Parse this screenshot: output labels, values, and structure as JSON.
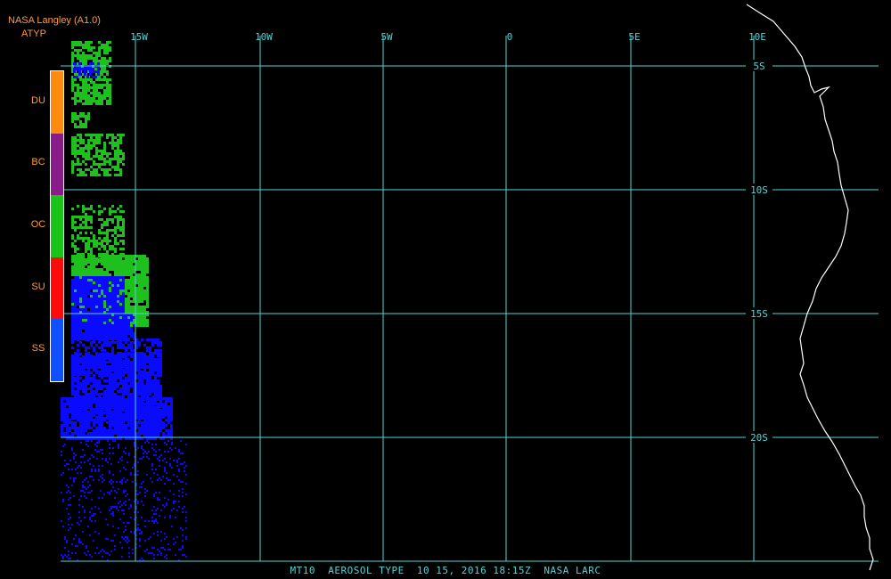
{
  "header": {
    "source": "NASA Langley (A1.0)",
    "product": "ATYP"
  },
  "colors": {
    "background": "#000000",
    "grid": "#4fd6d6",
    "coast": "#ffffff",
    "header_text": "#ff9a3c",
    "DU": "#ff8a10",
    "BC": "#8a1c8a",
    "OC": "#18c418",
    "SU": "#ff0a0a",
    "SS": "#1050ff",
    "map_blue": "#0a0aff",
    "map_green": "#1ec01e"
  },
  "legend": {
    "items": [
      {
        "code": "DU",
        "color": "#ff8a10"
      },
      {
        "code": "BC",
        "color": "#8a1c8a"
      },
      {
        "code": "OC",
        "color": "#18c418"
      },
      {
        "code": "SU",
        "color": "#ff0a0a"
      },
      {
        "code": "SS",
        "color": "#1050ff"
      }
    ]
  },
  "map": {
    "lon_labels": [
      "15W",
      "10W",
      "5W",
      "0",
      "5E",
      "10E"
    ],
    "lat_labels": [
      "5S",
      "10S",
      "15S",
      "20S"
    ],
    "lon_range": [
      -18,
      15
    ],
    "lat_range": [
      -25,
      -3
    ]
  },
  "footer": "MT10  AEROSOL TYPE  10 15, 2016 18:15Z  NASA LARC"
}
